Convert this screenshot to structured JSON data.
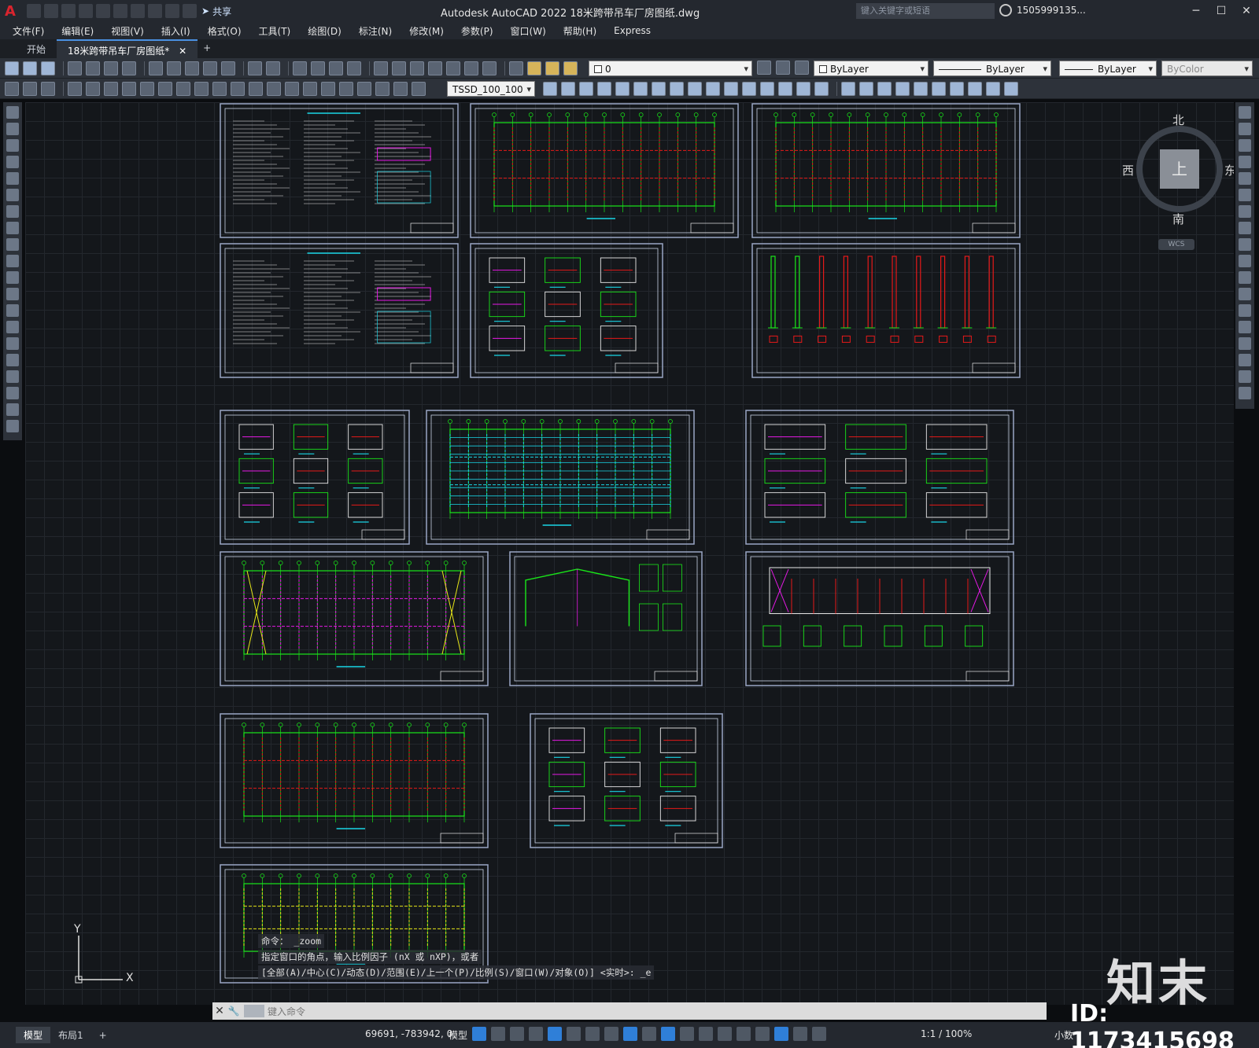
{
  "titlebar": {
    "app_logo": "A",
    "share_label": "共享",
    "title": "Autodesk AutoCAD 2022    18米跨带吊车厂房图纸.dwg",
    "search_placeholder": "键入关键字或短语",
    "user": "1505999135...",
    "min": "─",
    "max": "☐",
    "close": "✕"
  },
  "menu": [
    "文件(F)",
    "编辑(E)",
    "视图(V)",
    "插入(I)",
    "格式(O)",
    "工具(T)",
    "绘图(D)",
    "标注(N)",
    "修改(M)",
    "参数(P)",
    "窗口(W)",
    "帮助(H)",
    "Express"
  ],
  "tabs": {
    "start": "开始",
    "active": "18米跨带吊车厂房图纸*",
    "close": "✕",
    "plus": "+"
  },
  "toolbar": {
    "layer": "0",
    "color": "ByLayer",
    "linetype": "ByLayer",
    "lineweight": "ByLayer",
    "plotstyle": "ByColor",
    "dimstyle": "TSSD_100_100"
  },
  "viewcube": {
    "north": "北",
    "south": "南",
    "west": "西",
    "east": "东",
    "top": "上",
    "wcs": "WCS"
  },
  "ucs": {
    "y": "Y",
    "x": "X"
  },
  "command": {
    "history": [
      "命令： _zoom",
      "指定窗口的角点，输入比例因子 (nX 或 nXP)，或者",
      "[全部(A)/中心(C)/动态(D)/范围(E)/上一个(P)/比例(S)/窗口(W)/对象(O)] <实时>: _e"
    ],
    "placeholder": "键入命令",
    "close": "✕",
    "wrench": "🔧"
  },
  "status": {
    "model_tab": "模型",
    "layout_tab": "布局1",
    "plus": "+",
    "coords": "69691, -783942, 0",
    "space": "模型",
    "scale": "1:1 / 100%",
    "units": "小数"
  },
  "watermark": {
    "brand": "知末",
    "id": "ID: 1173415698"
  },
  "colors": {
    "grid": "#23272d",
    "canvas": "#14171b",
    "frame": "#9aa6c4",
    "green": "#19e619",
    "red": "#e61919",
    "magenta": "#e619e6",
    "cyan": "#19d6e6",
    "yellow": "#e6e619",
    "white": "#e8e8e8"
  },
  "sheets": [
    {
      "name": "general-notes-1",
      "style": "notes"
    },
    {
      "name": "foundation-plan",
      "style": "plan-red"
    },
    {
      "name": "column-layout-plan",
      "style": "plan-red-dense"
    },
    {
      "name": "general-notes-2",
      "style": "notes"
    },
    {
      "name": "foundation-details",
      "style": "details"
    },
    {
      "name": "column-details",
      "style": "columns"
    },
    {
      "name": "crane-beam-details",
      "style": "details"
    },
    {
      "name": "roof-purlin-plan",
      "style": "plan-cyan"
    },
    {
      "name": "connection-details",
      "style": "details"
    },
    {
      "name": "roof-bracing-plan",
      "style": "plan-magenta"
    },
    {
      "name": "frame-elevation",
      "style": "frame"
    },
    {
      "name": "wall-bracing-elevation",
      "style": "elevation"
    },
    {
      "name": "wall-purlin-plan",
      "style": "plan-red"
    },
    {
      "name": "gutter-details",
      "style": "details"
    },
    {
      "name": "ground-beam-plan",
      "style": "plan-yellow"
    }
  ]
}
